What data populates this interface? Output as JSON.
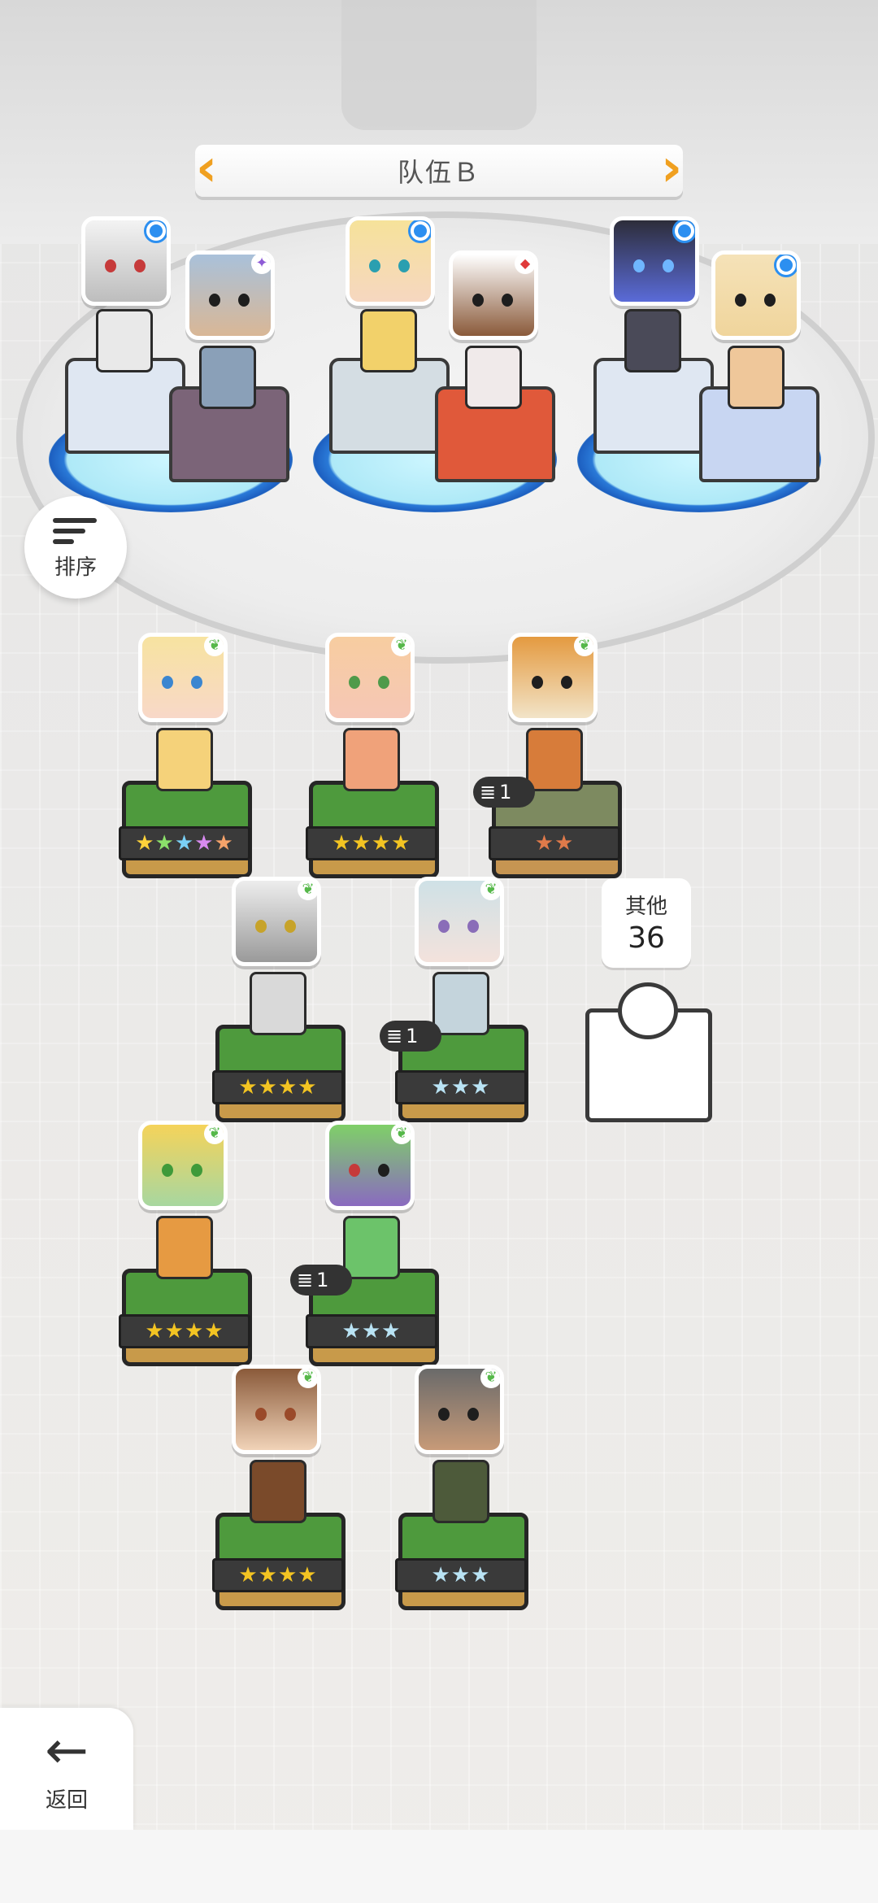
{
  "team": {
    "title": "队伍Ｂ"
  },
  "sort_button": {
    "label": "排序"
  },
  "back_button": {
    "label": "返回"
  },
  "others": {
    "label": "其他",
    "count": "36"
  },
  "colors": {
    "accent": "#f0a020",
    "badge_blue": "#2c8ff0",
    "leaf_green": "#56b84a",
    "grass": "#4e9a3d",
    "dirt": "#c89a4a"
  },
  "team_slots": [
    {
      "name": "wolf-knight",
      "badge": "dot-icon",
      "pedestal": "white"
    },
    {
      "name": "old-sage",
      "badge": "star-icon",
      "pedestal": "purple"
    },
    {
      "name": "blonde-cleric",
      "badge": "dot-icon",
      "pedestal": "stone"
    },
    {
      "name": "hooded-priestess",
      "badge": "diamond-icon",
      "pedestal": "red"
    },
    {
      "name": "dark-dragon",
      "badge": "dot-icon",
      "pedestal": "white"
    },
    {
      "name": "horned-beast",
      "badge": "dot-icon",
      "pedestal": "blue"
    }
  ],
  "roster": [
    {
      "name": "blonde-girl",
      "stars": "★★★★★",
      "tier": "rainbow",
      "dup": ""
    },
    {
      "name": "pink-girl",
      "stars": "★★★★",
      "tier": "gold",
      "dup": ""
    },
    {
      "name": "fox-beast",
      "stars": "★★",
      "tier": "bronze",
      "dup": "1"
    },
    {
      "name": "white-tiger",
      "stars": "★★★★",
      "tier": "gold",
      "dup": ""
    },
    {
      "name": "silver-hair-girl",
      "stars": "★★★",
      "tier": "silver",
      "dup": "1"
    },
    {
      "name": "fox-kid",
      "stars": "★★★★",
      "tier": "gold",
      "dup": ""
    },
    {
      "name": "green-goblin",
      "stars": "★★★",
      "tier": "silver",
      "dup": "1"
    },
    {
      "name": "brown-hair-girl",
      "stars": "★★★★",
      "tier": "gold",
      "dup": ""
    },
    {
      "name": "bearded-man",
      "stars": "★★★",
      "tier": "silver",
      "dup": ""
    }
  ]
}
